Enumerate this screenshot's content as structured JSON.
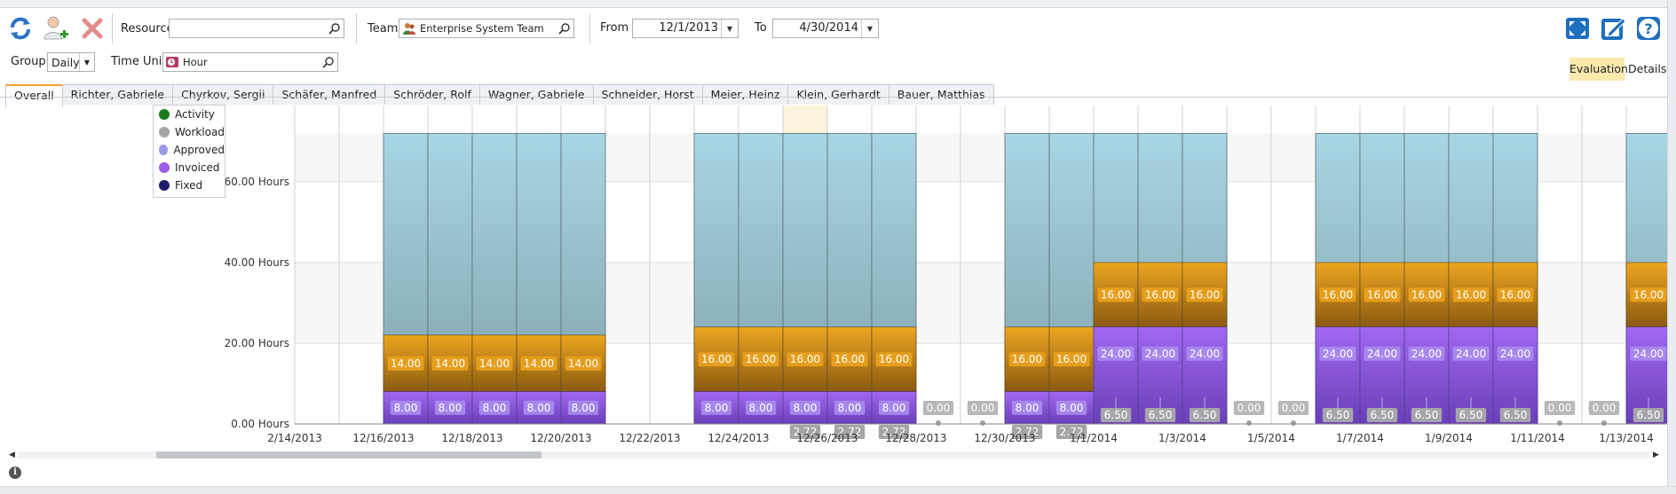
{
  "toolbar": {
    "resource_label": "Resource",
    "resource_value": "",
    "team_label": "Team",
    "team_value": "Enterprise System Team",
    "from_label": "From",
    "from_value": "12/1/2013",
    "to_label": "To",
    "to_value": "4/30/2014",
    "group_label": "Group",
    "group_value": "Daily",
    "time_unit_label": "Time Unit",
    "time_unit_value": "Hour",
    "evaluation_label": "Evaluation",
    "details_label": "Details",
    "icons": [
      "refresh-icon",
      "add-user-icon",
      "delete-icon",
      "fullscreen-icon",
      "edit-icon",
      "help-icon"
    ]
  },
  "tabs": [
    {
      "label": "Overall",
      "active": true
    },
    {
      "label": "Richter, Gabriele"
    },
    {
      "label": "Chyrkov, Sergii"
    },
    {
      "label": "Schäfer, Manfred"
    },
    {
      "label": "Schröder, Rolf"
    },
    {
      "label": "Wagner, Gabriele"
    },
    {
      "label": "Schneider, Horst"
    },
    {
      "label": "Meier, Heinz"
    },
    {
      "label": "Klein, Gerhardt"
    },
    {
      "label": "Bauer, Matthias"
    }
  ],
  "legend": [
    {
      "label": "Activity",
      "color": "#1a7a1a"
    },
    {
      "label": "Workload",
      "color": "#a6a6a6"
    },
    {
      "label": "Approved",
      "color": "#9a9ae8"
    },
    {
      "label": "Invoiced",
      "color": "#9b5de5"
    },
    {
      "label": "Fixed",
      "color": "#1f1d6b"
    }
  ],
  "chart_data": {
    "type": "bar",
    "ylim": [
      0,
      72
    ],
    "yticks": [
      {
        "value": 0,
        "label": "0.00 Hours"
      },
      {
        "value": 20,
        "label": "20.00 Hours"
      },
      {
        "value": 40,
        "label": "40.00 Hours"
      },
      {
        "value": 60,
        "label": "60.00 Hours"
      }
    ],
    "xtick_labels": [
      "2/14/2013",
      "12/16/2013",
      "12/18/2013",
      "12/20/2013",
      "12/22/2013",
      "12/24/2013",
      "12/26/2013",
      "12/28/2013",
      "12/30/2013",
      "1/1/2014",
      "1/3/2014",
      "1/5/2014",
      "1/7/2014",
      "1/9/2014",
      "1/11/2014",
      "1/13/2014"
    ],
    "colors": {
      "capacity": "#9ccbd8",
      "workload": "#e7a21e",
      "invoiced": "#9b5de5",
      "highlight": "#fbf3dc"
    },
    "highlight_day": 11,
    "days": [
      {
        "date": "12/14/2013",
        "capacity": 0,
        "workload": 0,
        "invoiced": 0
      },
      {
        "date": "12/15/2013",
        "capacity": 0,
        "workload": 0,
        "invoiced": 0
      },
      {
        "date": "12/16/2013",
        "capacity": 72,
        "workload": 14,
        "invoiced": 8
      },
      {
        "date": "12/17/2013",
        "capacity": 72,
        "workload": 14,
        "invoiced": 8
      },
      {
        "date": "12/18/2013",
        "capacity": 72,
        "workload": 14,
        "invoiced": 8
      },
      {
        "date": "12/19/2013",
        "capacity": 72,
        "workload": 14,
        "invoiced": 8
      },
      {
        "date": "12/20/2013",
        "capacity": 72,
        "workload": 14,
        "invoiced": 8
      },
      {
        "date": "12/21/2013",
        "capacity": 0,
        "workload": 0,
        "invoiced": 0
      },
      {
        "date": "12/22/2013",
        "capacity": 0,
        "workload": 0,
        "invoiced": 0
      },
      {
        "date": "12/23/2013",
        "capacity": 72,
        "workload": 16,
        "invoiced": 8
      },
      {
        "date": "12/24/2013",
        "capacity": 72,
        "workload": 16,
        "invoiced": 8
      },
      {
        "date": "12/25/2013",
        "capacity": 72,
        "workload": 16,
        "invoiced": 8,
        "extra": "2.72"
      },
      {
        "date": "12/26/2013",
        "capacity": 72,
        "workload": 16,
        "invoiced": 8,
        "extra": "2.72"
      },
      {
        "date": "12/27/2013",
        "capacity": 72,
        "workload": 16,
        "invoiced": 8,
        "extra": "2.72"
      },
      {
        "date": "12/28/2013",
        "capacity": 0,
        "workload": 0,
        "invoiced": 0,
        "zero": "0.00"
      },
      {
        "date": "12/29/2013",
        "capacity": 0,
        "workload": 0,
        "invoiced": 0,
        "zero": "0.00"
      },
      {
        "date": "12/30/2013",
        "capacity": 72,
        "workload": 16,
        "invoiced": 8,
        "extra": "2.72"
      },
      {
        "date": "12/31/2013",
        "capacity": 72,
        "workload": 16,
        "invoiced": 8,
        "extra": "2.72"
      },
      {
        "date": "1/1/2014",
        "capacity": 72,
        "workload": 16,
        "invoiced": 24,
        "bottom": "6.50"
      },
      {
        "date": "1/2/2014",
        "capacity": 72,
        "workload": 16,
        "invoiced": 24,
        "bottom": "6.50"
      },
      {
        "date": "1/3/2014",
        "capacity": 72,
        "workload": 16,
        "invoiced": 24,
        "bottom": "6.50"
      },
      {
        "date": "1/4/2014",
        "capacity": 0,
        "workload": 0,
        "invoiced": 0,
        "zero": "0.00"
      },
      {
        "date": "1/5/2014",
        "capacity": 0,
        "workload": 0,
        "invoiced": 0,
        "zero": "0.00"
      },
      {
        "date": "1/6/2014",
        "capacity": 72,
        "workload": 16,
        "invoiced": 24,
        "bottom": "6.50"
      },
      {
        "date": "1/7/2014",
        "capacity": 72,
        "workload": 16,
        "invoiced": 24,
        "bottom": "6.50"
      },
      {
        "date": "1/8/2014",
        "capacity": 72,
        "workload": 16,
        "invoiced": 24,
        "bottom": "6.50"
      },
      {
        "date": "1/9/2014",
        "capacity": 72,
        "workload": 16,
        "invoiced": 24,
        "bottom": "6.50"
      },
      {
        "date": "1/10/2014",
        "capacity": 72,
        "workload": 16,
        "invoiced": 24,
        "bottom": "6.50"
      },
      {
        "date": "1/11/2014",
        "capacity": 0,
        "workload": 0,
        "invoiced": 0,
        "zero": "0.00"
      },
      {
        "date": "1/12/2014",
        "capacity": 0,
        "workload": 0,
        "invoiced": 0,
        "zero": "0.00"
      },
      {
        "date": "1/13/2014",
        "capacity": 72,
        "workload": 16,
        "invoiced": 24,
        "bottom": "6.50"
      }
    ]
  }
}
